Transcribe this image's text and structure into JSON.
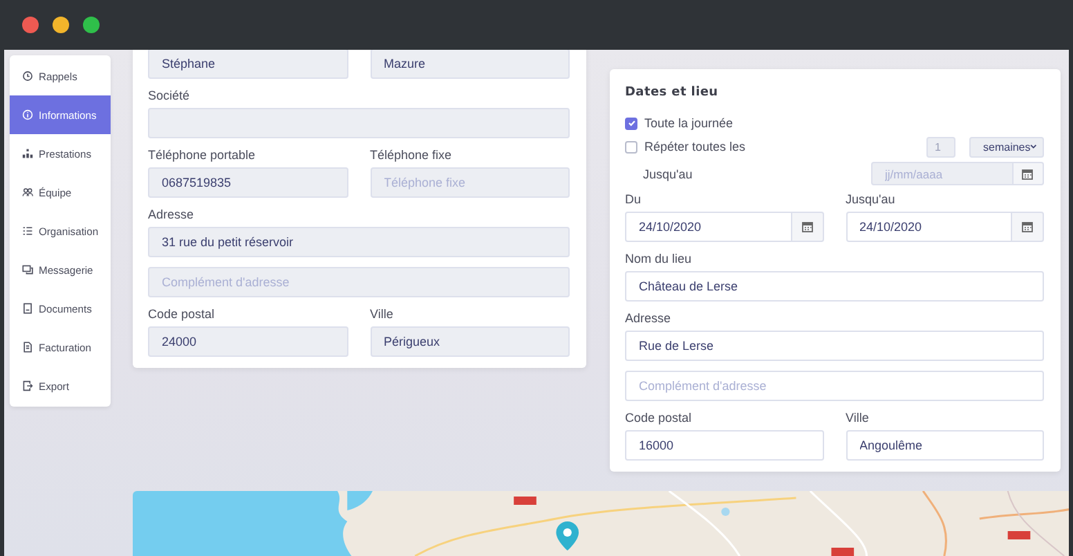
{
  "sidebar": {
    "items": [
      {
        "label": "Rappels",
        "selected": false
      },
      {
        "label": "Informations",
        "selected": true
      },
      {
        "label": "Prestations",
        "selected": false
      },
      {
        "label": "Équipe",
        "selected": false
      },
      {
        "label": "Organisation",
        "selected": false
      },
      {
        "label": "Messagerie",
        "selected": false
      },
      {
        "label": "Documents",
        "selected": false
      },
      {
        "label": "Facturation",
        "selected": false
      },
      {
        "label": "Export",
        "selected": false
      }
    ]
  },
  "contact_form": {
    "readonly": true,
    "rows": [
      [
        {
          "value": "Stéphane"
        },
        {
          "value": "Mazure"
        }
      ],
      [
        {
          "label": "Société"
        }
      ],
      [
        {
          "label": "Téléphone portable",
          "value": "0687519835"
        },
        {
          "label": "Téléphone fixe",
          "placeholder": "Téléphone fixe"
        }
      ],
      [
        {
          "label": "Adresse",
          "value": "31 rue du petit réservoir"
        }
      ],
      [
        {
          "placeholder": "Complément d'adresse"
        }
      ],
      [
        {
          "label": "Code postal",
          "value": "24000"
        },
        {
          "label": "Ville",
          "value": "Périgueux"
        }
      ]
    ]
  },
  "dates_card": {
    "title": "Dates et lieu",
    "all_day": {
      "label": "Toute la journée",
      "checked": true
    },
    "repeat": {
      "label": "Répéter toutes les",
      "checked": false,
      "count": "1",
      "unit": "semaines"
    },
    "repeat_until": {
      "label": "Jusqu'au",
      "placeholder": "jj/mm/aaaa",
      "disabled": true
    },
    "rows": [
      [
        {
          "label": "Du",
          "value": "24/10/2020",
          "kind": "date"
        },
        {
          "label": "Jusqu'au",
          "value": "24/10/2020",
          "kind": "date"
        }
      ],
      [
        {
          "label": "Nom du lieu",
          "value": "Château de Lerse",
          "kind": "text"
        }
      ],
      [
        {
          "label": "Adresse",
          "value": "Rue de Lerse",
          "kind": "text"
        }
      ],
      [
        {
          "placeholder": "Complément d'adresse",
          "kind": "text"
        }
      ],
      [
        {
          "label": "Code postal",
          "value": "16000",
          "kind": "text"
        },
        {
          "label": "Ville",
          "value": "Angoulême",
          "kind": "text"
        }
      ]
    ]
  }
}
